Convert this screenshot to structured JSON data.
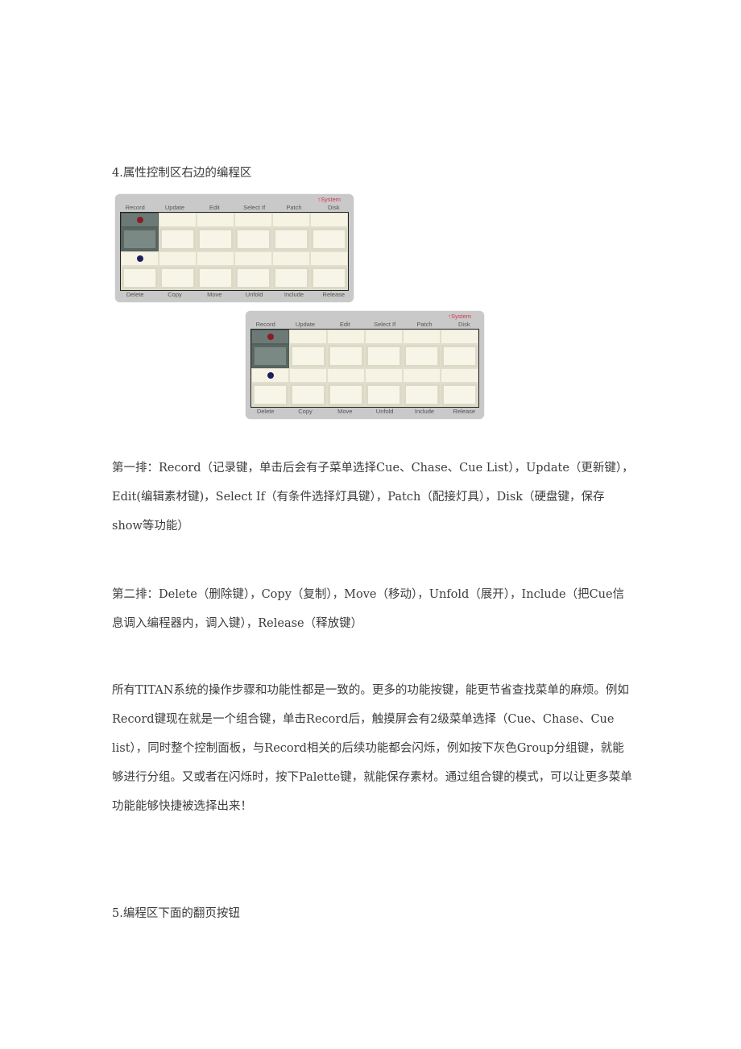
{
  "section4_heading": "4.属性控制区右边的编程区",
  "panel": {
    "system_label": "↑System",
    "top_row": [
      "Record",
      "Update",
      "Edit",
      "Select If",
      "Patch",
      "Disk"
    ],
    "bottom_row": [
      "Delete",
      "Copy",
      "Move",
      "Unfold",
      "Include",
      "Release"
    ],
    "colors": {
      "record_indicator": "#8a1c24",
      "delete_indicator": "#1b1f5c",
      "system_label": "#d9364b"
    }
  },
  "paragraphs": {
    "row1": "第一排：Record（记录键，单击后会有子菜单选择Cue、Chase、Cue List），Update（更新键），Edit(编辑素材键)，Select If（有条件选择灯具键），Patch（配接灯具），Disk（硬盘键，保存show等功能）",
    "row2": "第二排：Delete（删除键），Copy（复制），Move（移动），Unfold（展开），Include（把Cue信息调入编程器内，调入键），Release（释放键）",
    "titan": "所有TITAN系统的操作步骤和功能性都是一致的。更多的功能按键，能更节省查找菜单的麻烦。例如Record键现在就是一个组合键，单击Record后，触摸屏会有2级菜单选择（Cue、Chase、Cue list），同时整个控制面板，与Record相关的后续功能都会闪烁，例如按下灰色Group分组键，就能够进行分组。又或者在闪烁时，按下Palette键，就能保存素材。通过组合键的模式，可以让更多菜单功能能够快捷被选择出来！"
  },
  "section5_heading": "5.编程区下面的翻页按钮"
}
